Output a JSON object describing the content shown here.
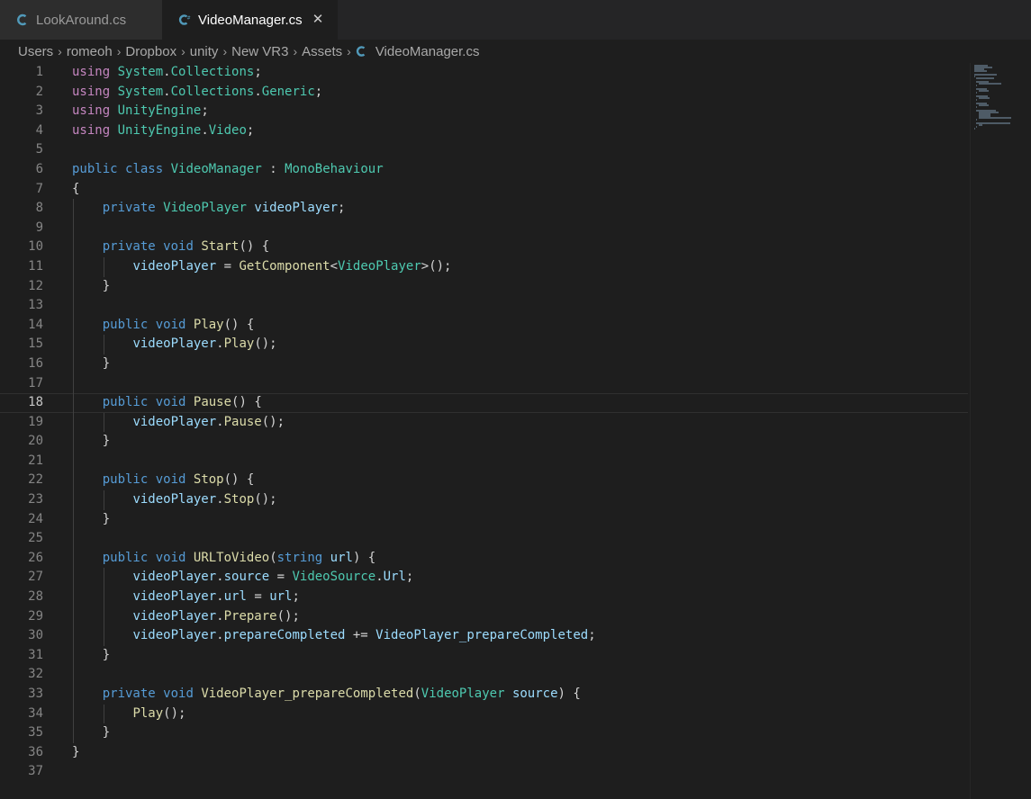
{
  "tabs": [
    {
      "label": "LookAround.cs",
      "active": false
    },
    {
      "label": "VideoManager.cs",
      "active": true
    }
  ],
  "breadcrumb": [
    "Users",
    "romeoh",
    "Dropbox",
    "unity",
    "New VR3",
    "Assets",
    "VideoManager.cs"
  ],
  "icons": {
    "file": "csharp-file-icon",
    "close": "close-icon",
    "separator": "chevron-right-icon"
  },
  "colors": {
    "background": "#1e1e1e",
    "tabbar": "#252526",
    "keyword": "#569cd6",
    "using": "#c586c0",
    "type": "#4ec9b0",
    "function": "#dcdcaa",
    "variable": "#9cdcfe",
    "text": "#d4d4d4",
    "line_number": "#858585",
    "csharp_icon": "#519aba"
  },
  "editor": {
    "current_line": 18,
    "lines": [
      [
        [
          "using",
          "u"
        ],
        [
          " "
        ],
        [
          "System",
          "t"
        ],
        [
          "."
        ],
        [
          "Collections",
          "t"
        ],
        [
          ";"
        ]
      ],
      [
        [
          "using",
          "u"
        ],
        [
          " "
        ],
        [
          "System",
          "t"
        ],
        [
          "."
        ],
        [
          "Collections",
          "t"
        ],
        [
          "."
        ],
        [
          "Generic",
          "t"
        ],
        [
          ";"
        ]
      ],
      [
        [
          "using",
          "u"
        ],
        [
          " "
        ],
        [
          "UnityEngine",
          "t"
        ],
        [
          ";"
        ]
      ],
      [
        [
          "using",
          "u"
        ],
        [
          " "
        ],
        [
          "UnityEngine",
          "t"
        ],
        [
          "."
        ],
        [
          "Video",
          "t"
        ],
        [
          ";"
        ]
      ],
      [],
      [
        [
          "public",
          "k"
        ],
        [
          " "
        ],
        [
          "class",
          "k"
        ],
        [
          " "
        ],
        [
          "VideoManager",
          "t"
        ],
        [
          " : "
        ],
        [
          "MonoBehaviour",
          "t"
        ]
      ],
      [
        [
          "{"
        ]
      ],
      [
        [
          "    "
        ],
        [
          "private",
          "k"
        ],
        [
          " "
        ],
        [
          "VideoPlayer",
          "t"
        ],
        [
          " "
        ],
        [
          "videoPlayer",
          "i"
        ],
        [
          ";"
        ]
      ],
      [],
      [
        [
          "    "
        ],
        [
          "private",
          "k"
        ],
        [
          " "
        ],
        [
          "void",
          "k"
        ],
        [
          " "
        ],
        [
          "Start",
          "f"
        ],
        [
          "() {"
        ]
      ],
      [
        [
          "        "
        ],
        [
          "videoPlayer",
          "i"
        ],
        [
          " = "
        ],
        [
          "GetComponent",
          "f"
        ],
        [
          "<"
        ],
        [
          "VideoPlayer",
          "t"
        ],
        [
          ">();"
        ]
      ],
      [
        [
          "    }"
        ]
      ],
      [],
      [
        [
          "    "
        ],
        [
          "public",
          "k"
        ],
        [
          " "
        ],
        [
          "void",
          "k"
        ],
        [
          " "
        ],
        [
          "Play",
          "f"
        ],
        [
          "() {"
        ]
      ],
      [
        [
          "        "
        ],
        [
          "videoPlayer",
          "i"
        ],
        [
          "."
        ],
        [
          "Play",
          "f"
        ],
        [
          "();"
        ]
      ],
      [
        [
          "    }"
        ]
      ],
      [],
      [
        [
          "    "
        ],
        [
          "public",
          "k"
        ],
        [
          " "
        ],
        [
          "void",
          "k"
        ],
        [
          " "
        ],
        [
          "Pause",
          "f"
        ],
        [
          "() {"
        ]
      ],
      [
        [
          "        "
        ],
        [
          "videoPlayer",
          "i"
        ],
        [
          "."
        ],
        [
          "Pause",
          "f"
        ],
        [
          "();"
        ]
      ],
      [
        [
          "    }"
        ]
      ],
      [],
      [
        [
          "    "
        ],
        [
          "public",
          "k"
        ],
        [
          " "
        ],
        [
          "void",
          "k"
        ],
        [
          " "
        ],
        [
          "Stop",
          "f"
        ],
        [
          "() {"
        ]
      ],
      [
        [
          "        "
        ],
        [
          "videoPlayer",
          "i"
        ],
        [
          "."
        ],
        [
          "Stop",
          "f"
        ],
        [
          "();"
        ]
      ],
      [
        [
          "    }"
        ]
      ],
      [],
      [
        [
          "    "
        ],
        [
          "public",
          "k"
        ],
        [
          " "
        ],
        [
          "void",
          "k"
        ],
        [
          " "
        ],
        [
          "URLToVideo",
          "f"
        ],
        [
          "("
        ],
        [
          "string",
          "k"
        ],
        [
          " "
        ],
        [
          "url",
          "i"
        ],
        [
          ") {"
        ]
      ],
      [
        [
          "        "
        ],
        [
          "videoPlayer",
          "i"
        ],
        [
          "."
        ],
        [
          "source",
          "i"
        ],
        [
          " = "
        ],
        [
          "VideoSource",
          "t"
        ],
        [
          "."
        ],
        [
          "Url",
          "i"
        ],
        [
          ";"
        ]
      ],
      [
        [
          "        "
        ],
        [
          "videoPlayer",
          "i"
        ],
        [
          "."
        ],
        [
          "url",
          "i"
        ],
        [
          " = "
        ],
        [
          "url",
          "i"
        ],
        [
          ";"
        ]
      ],
      [
        [
          "        "
        ],
        [
          "videoPlayer",
          "i"
        ],
        [
          "."
        ],
        [
          "Prepare",
          "f"
        ],
        [
          "();"
        ]
      ],
      [
        [
          "        "
        ],
        [
          "videoPlayer",
          "i"
        ],
        [
          "."
        ],
        [
          "prepareCompleted",
          "i"
        ],
        [
          " += "
        ],
        [
          "VideoPlayer_prepareCompleted",
          "i"
        ],
        [
          ";"
        ]
      ],
      [
        [
          "    }"
        ]
      ],
      [],
      [
        [
          "    "
        ],
        [
          "private",
          "k"
        ],
        [
          " "
        ],
        [
          "void",
          "k"
        ],
        [
          " "
        ],
        [
          "VideoPlayer_prepareCompleted",
          "f"
        ],
        [
          "("
        ],
        [
          "VideoPlayer",
          "t"
        ],
        [
          " "
        ],
        [
          "source",
          "i"
        ],
        [
          ") {"
        ]
      ],
      [
        [
          "        "
        ],
        [
          "Play",
          "f"
        ],
        [
          "();"
        ]
      ],
      [
        [
          "    }"
        ]
      ],
      [
        [
          "}"
        ]
      ],
      []
    ]
  }
}
